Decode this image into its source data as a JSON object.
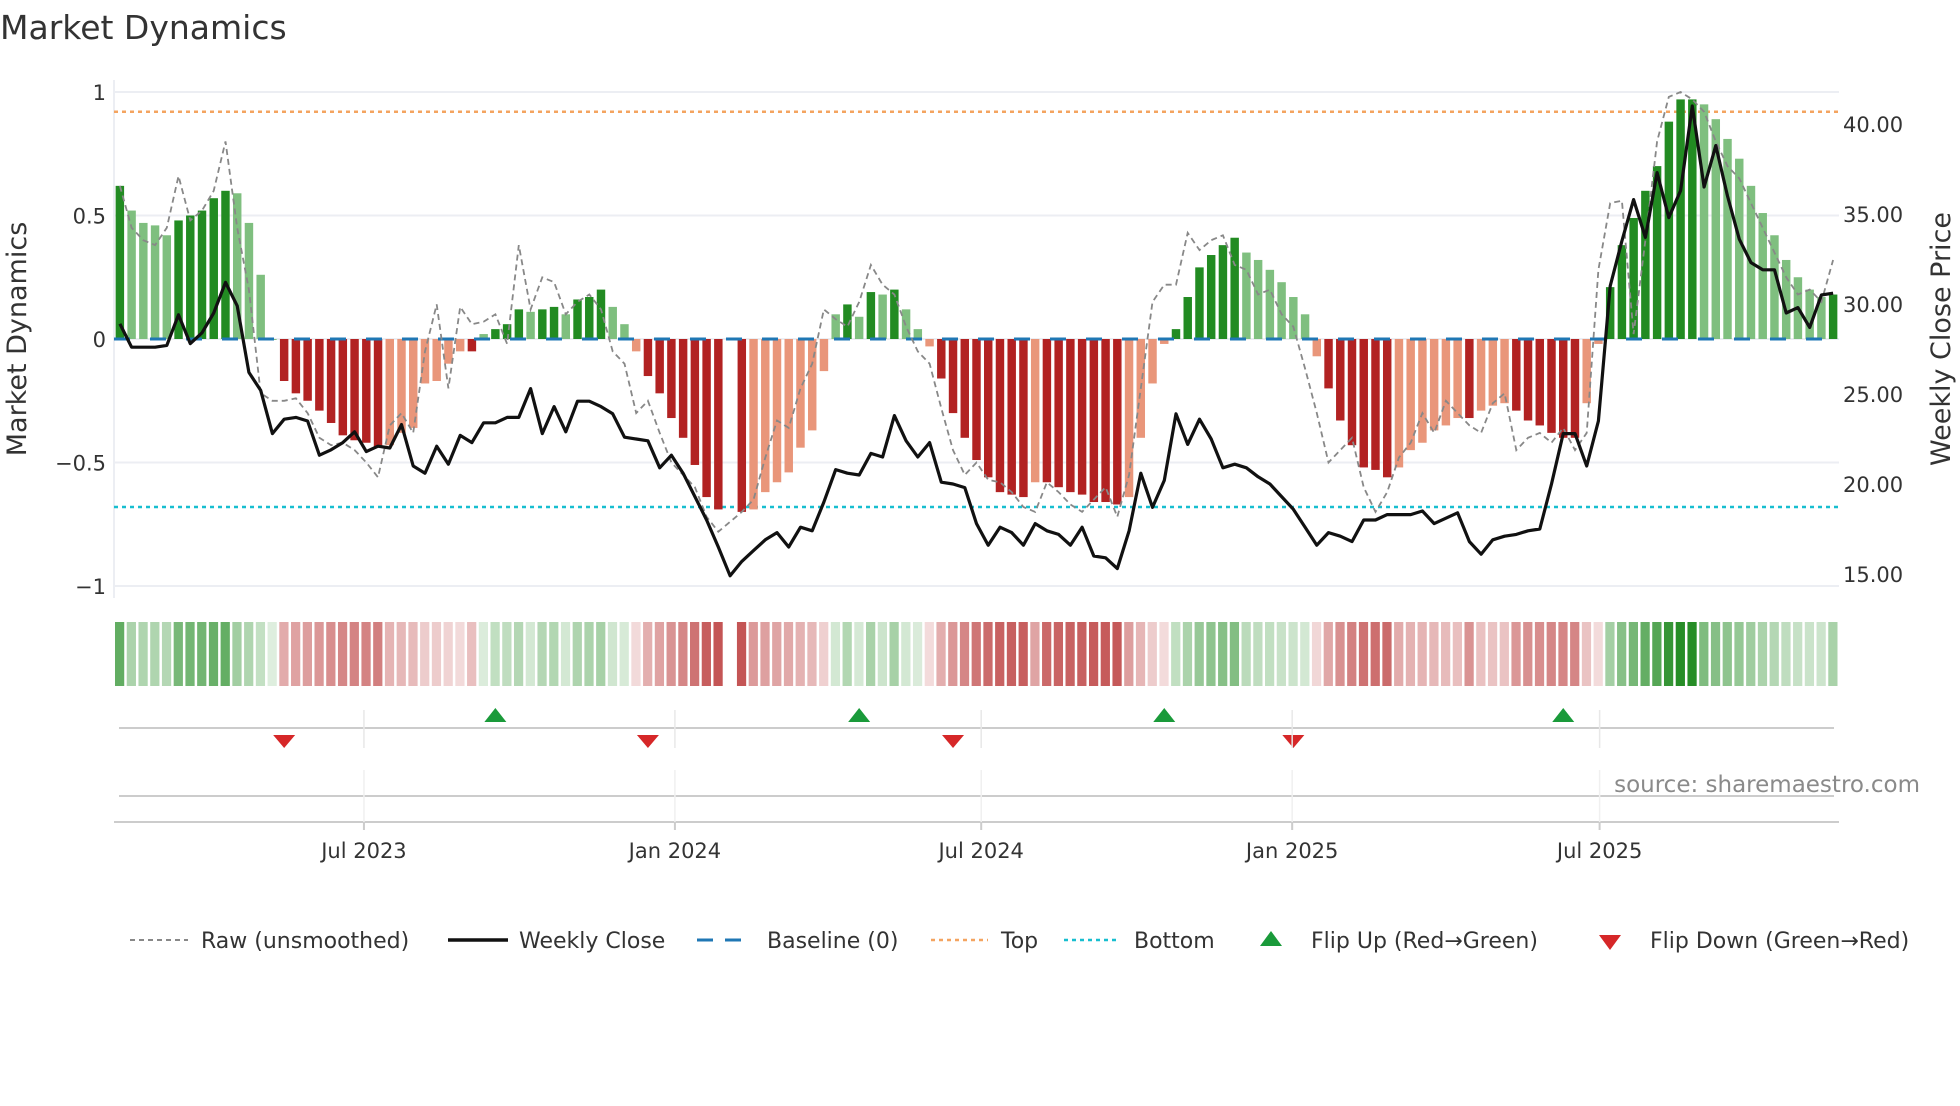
{
  "chart_data": {
    "type": "bar",
    "title": "Market Dynamics",
    "ylabel_left": "Market Dynamics",
    "ylabel_right": "Weekly Close Price",
    "ylim_left": [
      -1.03,
      1.03
    ],
    "ylim_right": [
      13.4,
      42.3
    ],
    "yticks_left": [
      {
        "v": 1,
        "label": "1"
      },
      {
        "v": 0.5,
        "label": "0.5"
      },
      {
        "v": 0,
        "label": "0"
      },
      {
        "v": -0.5,
        "label": "−0.5"
      },
      {
        "v": -1,
        "label": "−1"
      }
    ],
    "yticks_right": [
      {
        "v": 40,
        "label": "40.00"
      },
      {
        "v": 35,
        "label": "35.00"
      },
      {
        "v": 30,
        "label": "30.00"
      },
      {
        "v": 25,
        "label": "25.00"
      },
      {
        "v": 20,
        "label": "20.00"
      },
      {
        "v": 15,
        "label": "15.00"
      }
    ],
    "xticks": [
      {
        "week": 21.3,
        "label": "Jul 2023"
      },
      {
        "week": 47.8,
        "label": "Jan 2024"
      },
      {
        "week": 73.9,
        "label": "Jul 2024"
      },
      {
        "week": 100.4,
        "label": "Jan 2025"
      },
      {
        "week": 126.6,
        "label": "Jul 2025"
      }
    ],
    "top_level": 0.92,
    "bottom_level": -0.68,
    "baseline": 0,
    "colors": {
      "green_strong": "#228b22",
      "green_weak": "#7fbf7f",
      "red_strong": "#b22222",
      "red_weak": "#e9967a",
      "baseline": "#1f77b4",
      "top": "#f4a460",
      "bottom": "#17becf",
      "raw": "#888888",
      "close": "#111111",
      "flip_up": "#1a9a3a",
      "flip_down": "#d62728"
    },
    "dynamics": [
      0.62,
      0.52,
      0.47,
      0.46,
      0.42,
      0.48,
      0.5,
      0.52,
      0.57,
      0.6,
      0.59,
      0.47,
      0.26,
      0.0,
      -0.17,
      -0.22,
      -0.25,
      -0.29,
      -0.34,
      -0.39,
      -0.41,
      -0.42,
      -0.44,
      -0.43,
      -0.38,
      -0.36,
      -0.18,
      -0.17,
      -0.1,
      -0.05,
      -0.05,
      0.02,
      0.04,
      0.06,
      0.12,
      0.11,
      0.12,
      0.13,
      0.1,
      0.16,
      0.17,
      0.2,
      0.13,
      0.06,
      -0.05,
      -0.15,
      -0.22,
      -0.32,
      -0.4,
      -0.51,
      -0.64,
      -0.69,
      null,
      -0.7,
      -0.69,
      -0.62,
      -0.58,
      -0.54,
      -0.44,
      -0.37,
      -0.13,
      0.1,
      0.14,
      0.09,
      0.19,
      0.18,
      0.2,
      0.12,
      0.04,
      -0.03,
      -0.16,
      -0.3,
      -0.4,
      -0.49,
      -0.56,
      -0.62,
      -0.63,
      -0.64,
      -0.58,
      -0.58,
      -0.6,
      -0.62,
      -0.63,
      -0.66,
      -0.66,
      -0.67,
      -0.64,
      -0.4,
      -0.18,
      -0.02,
      0.04,
      0.17,
      0.29,
      0.34,
      0.38,
      0.41,
      0.35,
      0.32,
      0.28,
      0.23,
      0.17,
      0.1,
      -0.07,
      -0.2,
      -0.33,
      -0.43,
      -0.52,
      -0.53,
      -0.56,
      -0.52,
      -0.45,
      -0.42,
      -0.37,
      -0.35,
      -0.32,
      -0.32,
      -0.29,
      -0.27,
      -0.26,
      -0.29,
      -0.33,
      -0.35,
      -0.38,
      -0.4,
      -0.4,
      -0.26,
      -0.02,
      0.21,
      0.38,
      0.49,
      0.6,
      0.7,
      0.88,
      0.97,
      0.97,
      0.95,
      0.89,
      0.81,
      0.73,
      0.62,
      0.51,
      0.42,
      0.32,
      0.25,
      0.2,
      0.17,
      0.18
    ],
    "raw": [
      0.62,
      0.45,
      0.4,
      0.38,
      0.45,
      0.66,
      0.48,
      0.52,
      0.6,
      0.8,
      0.45,
      0.2,
      -0.22,
      -0.25,
      -0.25,
      -0.24,
      -0.3,
      -0.4,
      -0.43,
      -0.42,
      -0.45,
      -0.5,
      -0.56,
      -0.35,
      -0.3,
      -0.38,
      -0.05,
      0.14,
      -0.2,
      0.13,
      0.06,
      0.07,
      0.1,
      -0.02,
      0.38,
      0.12,
      0.25,
      0.23,
      0.1,
      0.15,
      0.18,
      0.12,
      -0.05,
      -0.1,
      -0.3,
      -0.25,
      -0.38,
      -0.5,
      -0.55,
      -0.6,
      -0.72,
      -0.78,
      -0.74,
      -0.7,
      -0.65,
      -0.48,
      -0.33,
      -0.36,
      -0.2,
      -0.1,
      0.12,
      0.08,
      0.05,
      0.15,
      0.3,
      0.22,
      0.18,
      0.05,
      -0.05,
      -0.1,
      -0.28,
      -0.45,
      -0.55,
      -0.5,
      -0.57,
      -0.58,
      -0.62,
      -0.68,
      -0.7,
      -0.58,
      -0.62,
      -0.67,
      -0.7,
      -0.65,
      -0.6,
      -0.72,
      -0.55,
      -0.2,
      0.15,
      0.22,
      0.22,
      0.43,
      0.36,
      0.4,
      0.42,
      0.3,
      0.28,
      0.18,
      0.2,
      0.1,
      0.05,
      -0.12,
      -0.3,
      -0.5,
      -0.45,
      -0.4,
      -0.6,
      -0.7,
      -0.62,
      -0.48,
      -0.42,
      -0.3,
      -0.38,
      -0.25,
      -0.3,
      -0.35,
      -0.38,
      -0.26,
      -0.22,
      -0.45,
      -0.4,
      -0.38,
      -0.42,
      -0.36,
      -0.45,
      -0.38,
      0.28,
      0.55,
      0.56,
      0.02,
      0.4,
      0.8,
      0.98,
      1.0,
      0.97,
      0.92,
      0.8,
      0.7,
      0.65,
      0.55,
      0.45,
      0.35,
      0.25,
      0.18,
      0.2,
      0.15,
      0.32
    ],
    "weekly_close": [
      28.9,
      27.6,
      27.6,
      27.6,
      27.7,
      29.4,
      27.8,
      28.4,
      29.5,
      31.2,
      29.9,
      26.2,
      25.2,
      22.8,
      23.6,
      23.7,
      23.5,
      21.6,
      21.9,
      22.3,
      22.9,
      21.8,
      22.1,
      22.0,
      23.3,
      21.0,
      20.6,
      22.1,
      21.1,
      22.7,
      22.3,
      23.4,
      23.4,
      23.7,
      23.7,
      25.3,
      22.8,
      24.3,
      22.9,
      24.6,
      24.6,
      24.3,
      23.9,
      22.6,
      22.5,
      22.4,
      20.9,
      21.6,
      20.6,
      19.3,
      18.0,
      16.5,
      14.9,
      15.7,
      16.3,
      16.9,
      17.3,
      16.5,
      17.6,
      17.4,
      19.0,
      20.8,
      20.6,
      20.5,
      21.7,
      21.5,
      23.8,
      22.4,
      21.5,
      22.3,
      20.1,
      20.0,
      19.8,
      17.8,
      16.6,
      17.6,
      17.3,
      16.6,
      17.8,
      17.4,
      17.2,
      16.6,
      17.6,
      16.0,
      15.9,
      15.3,
      17.4,
      20.6,
      18.7,
      20.2,
      23.9,
      22.2,
      23.6,
      22.5,
      20.9,
      21.1,
      20.9,
      20.4,
      20.0,
      19.3,
      18.6,
      17.6,
      16.6,
      17.3,
      17.1,
      16.8,
      18.0,
      18.0,
      18.3,
      18.3,
      18.3,
      18.5,
      17.8,
      18.1,
      18.4,
      16.8,
      16.1,
      16.9,
      17.1,
      17.2,
      17.4,
      17.5,
      20.0,
      22.8,
      22.8,
      21.0,
      23.5,
      31.0,
      33.5,
      35.8,
      33.7,
      37.3,
      34.8,
      36.3,
      41.0,
      36.5,
      38.8,
      36.0,
      33.6,
      32.3,
      31.9,
      31.9,
      29.5,
      29.8,
      28.7,
      30.5,
      30.6
    ],
    "flips": [
      {
        "type": "down",
        "week": 14
      },
      {
        "type": "up",
        "week": 32
      },
      {
        "type": "down",
        "week": 45
      },
      {
        "type": "up",
        "week": 63
      },
      {
        "type": "down",
        "week": 71
      },
      {
        "type": "up",
        "week": 89
      },
      {
        "type": "down",
        "week": 100
      },
      {
        "type": "up",
        "week": 123
      }
    ],
    "legend": {
      "raw": "Raw (unsmoothed)",
      "close": "Weekly Close",
      "baseline": "Baseline (0)",
      "top": "Top",
      "bottom": "Bottom",
      "flip_up": "Flip Up (Red→Green)",
      "flip_down": "Flip Down (Green→Red)"
    },
    "legend_placement": "bottom",
    "source": "source: sharemaestro.com"
  }
}
